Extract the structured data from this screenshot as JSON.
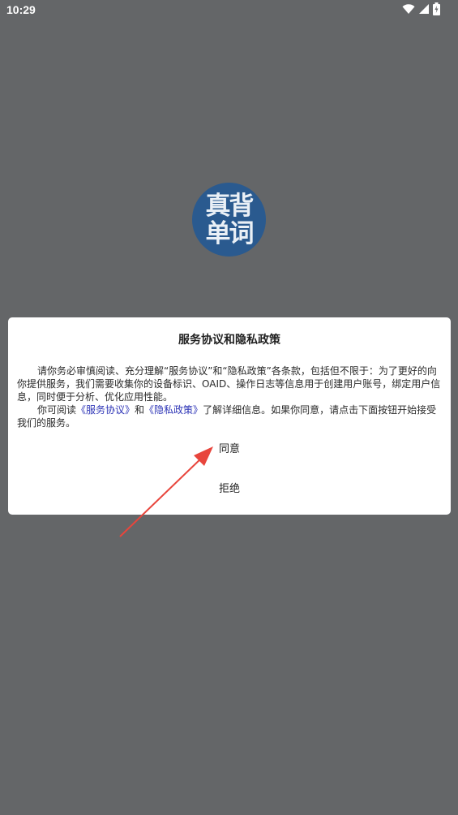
{
  "status_bar": {
    "time": "10:29",
    "icons": [
      "wifi-icon",
      "signal-icon",
      "battery-icon"
    ]
  },
  "logo": {
    "line1": "真背",
    "line2": "单词",
    "color": "#2a5a8f"
  },
  "dialog": {
    "title": "服务协议和隐私政策",
    "paragraph1": "请你务必审慎阅读、充分理解“服务协议”和“隐私政策”各条款，包括但不限于：为了更好的向你提供服务，我们需要收集你的设备标识、OAID、操作日志等信息用于创建用户账号，绑定用户信息，同时便于分析、优化应用性能。",
    "paragraph2_prefix": "你可阅读",
    "service_link": "《服务协议》",
    "and_text": "和",
    "privacy_link": "《隐私政策》",
    "paragraph2_suffix": "了解详细信息。如果你同意，请点击下面按钮开始接受我们的服务。",
    "agree_label": "同意",
    "reject_label": "拒绝",
    "link_color": "#2d34b6"
  },
  "annotation": {
    "arrow_color": "#e8453c"
  }
}
